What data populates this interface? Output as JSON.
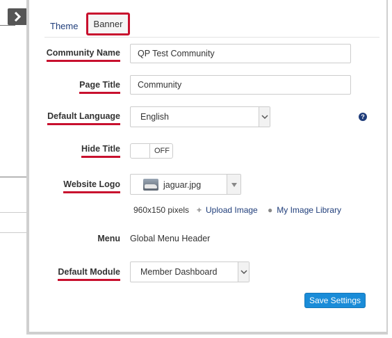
{
  "tabs": [
    {
      "label": "Theme"
    },
    {
      "label": "Banner"
    }
  ],
  "form": {
    "community_name": {
      "label": "Community Name",
      "value": "QP Test Community"
    },
    "page_title": {
      "label": "Page Title",
      "value": "Community"
    },
    "default_language": {
      "label": "Default Language",
      "value": "English"
    },
    "hide_title": {
      "label": "Hide Title",
      "state": "OFF"
    },
    "website_logo": {
      "label": "Website Logo",
      "file": "jaguar.jpg",
      "dimensions": "960x150 pixels",
      "upload_label": "Upload Image",
      "library_label": "My Image Library"
    },
    "menu": {
      "label": "Menu",
      "value": "Global Menu Header"
    },
    "default_module": {
      "label": "Default Module",
      "value": "Member Dashboard"
    }
  },
  "actions": {
    "save_label": "Save Settings"
  },
  "icons": {
    "help": "question-circle-icon",
    "sidebar_toggle": "chevron-right-icon",
    "upload": "plus-icon",
    "library": "user-icon"
  },
  "colors": {
    "accent": "#1f3d7a",
    "highlight": "#c8102e",
    "button": "#1a8cd8"
  }
}
